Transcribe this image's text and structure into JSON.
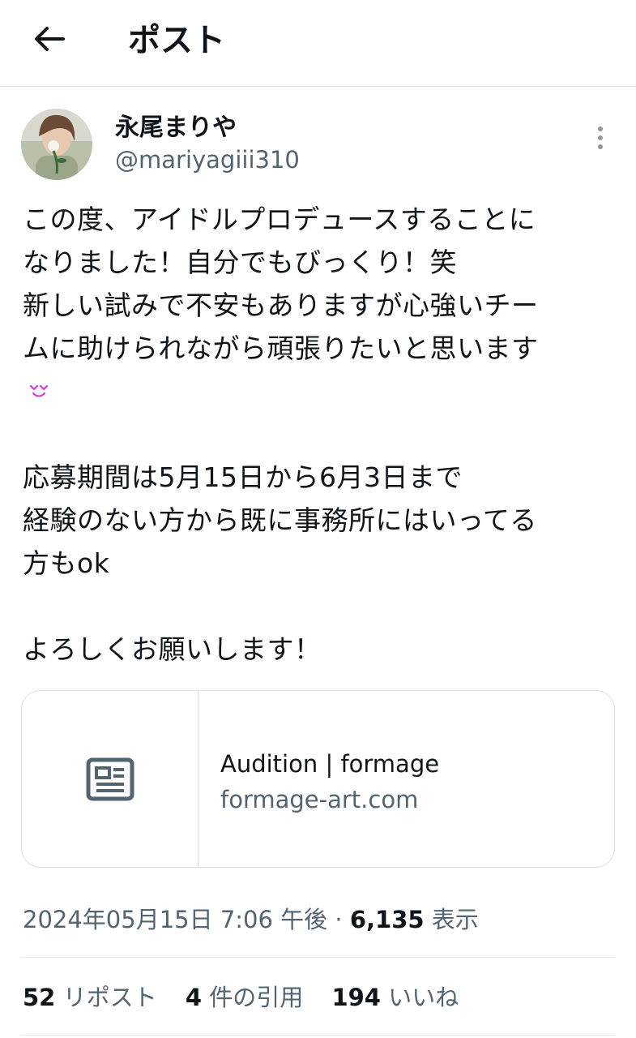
{
  "header": {
    "title": "ポスト"
  },
  "author": {
    "display_name": "永尾まりや",
    "handle": "@mariyagiii310"
  },
  "post": {
    "lines": [
      "この度、アイドルプロデュースすることに",
      "なりました！自分でもびっくり！笑",
      "新しい試みで不安もありますが心強いチー",
      "ムに助けられながら頑張りたいと思います"
    ],
    "emoji": "smiling-face-icon",
    "lines2": [
      "応募期間は5月15日から6月3日まで",
      "経験のない方から既に事務所にはいってる",
      "方もok"
    ],
    "lines3": [
      "よろしくお願いします！"
    ]
  },
  "link_card": {
    "icon": "news-article-icon",
    "title": "Audition | formage",
    "domain": "formage-art.com"
  },
  "meta": {
    "timestamp": "2024年05月15日 7:06 午後",
    "separator": "·",
    "views": "6,135",
    "views_label": "表示"
  },
  "stats": {
    "reposts": "52",
    "reposts_label": "リポスト",
    "quotes": "4",
    "quotes_label": "件の引用",
    "likes": "194",
    "likes_label": "いいね"
  },
  "colors": {
    "text": "#0f1419",
    "secondary": "#536471",
    "border": "#dde2e6",
    "emoji_accent": "#d93ad9"
  }
}
